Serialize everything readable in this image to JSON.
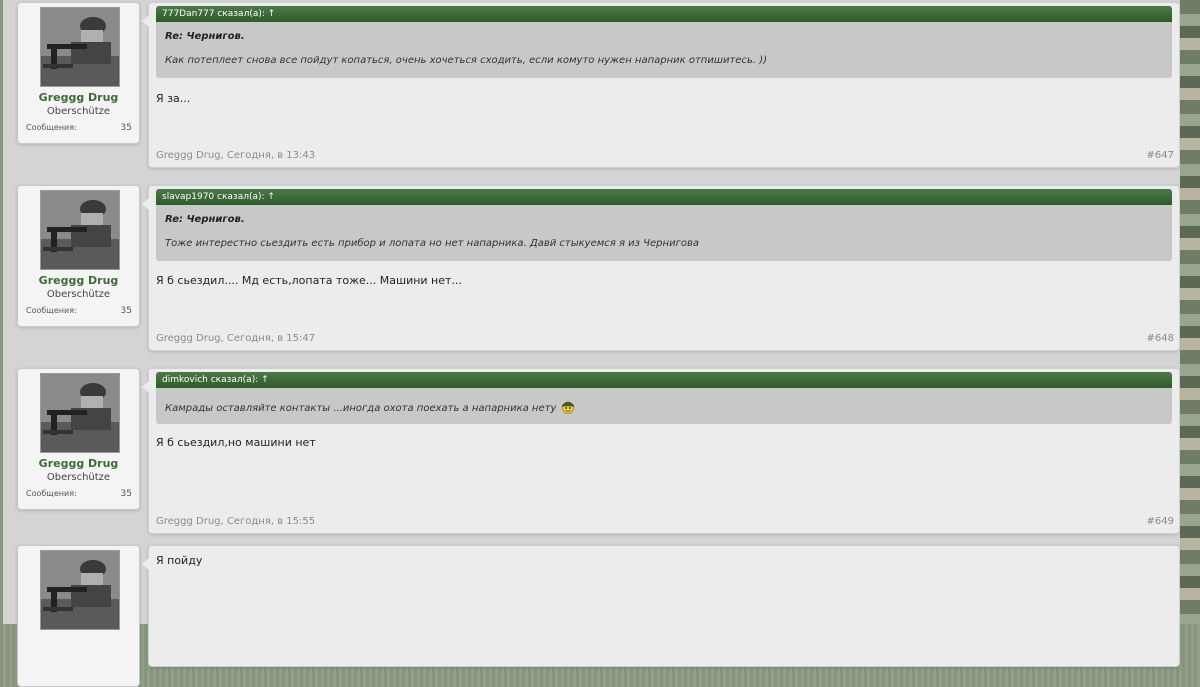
{
  "posts": [
    {
      "user": {
        "name": "Greggg Drug",
        "title": "Oberschütze",
        "messages_label": "Сообщения:",
        "messages_count": "35"
      },
      "quote": {
        "header": "777Dan777 сказал(а): ↑",
        "title": "Re: Чернигов.",
        "text": "Как потеплеет снова все пойдут копаться, очень хочеться сходить, если комуто нужен напарник отпишитесь. ))"
      },
      "text": "Я за...",
      "meta": "Greggg Drug, Сегодня, в 13:43",
      "number": "#647"
    },
    {
      "user": {
        "name": "Greggg Drug",
        "title": "Oberschütze",
        "messages_label": "Сообщения:",
        "messages_count": "35"
      },
      "quote": {
        "header": "slavap1970 сказал(а): ↑",
        "title": "Re: Чернигов.",
        "text": "Тоже интерестно сьездить есть прибор и лопата но нет напарника. Давй стыкуемся я из Чернигова"
      },
      "text": "Я б сьездил.... Мд есть,лопата тоже... Машини нет...",
      "meta": "Greggg Drug, Сегодня, в 15:47",
      "number": "#648"
    },
    {
      "user": {
        "name": "Greggg Drug",
        "title": "Oberschütze",
        "messages_label": "Сообщения:",
        "messages_count": "35"
      },
      "quote": {
        "header": "dimkovich сказал(а): ↑",
        "text": "Камрады оставляйте контакты ...иногда охота поехать а напарника нету",
        "smiley": "helmet-smiley-icon"
      },
      "text": "Я б сьездил,но машини нет",
      "meta": "Greggg Drug, Сегодня, в 15:55",
      "number": "#649"
    },
    {
      "text": "Я пойду"
    }
  ],
  "colors": {
    "quote_header": "#3d6a37",
    "username": "#3d6a37"
  }
}
